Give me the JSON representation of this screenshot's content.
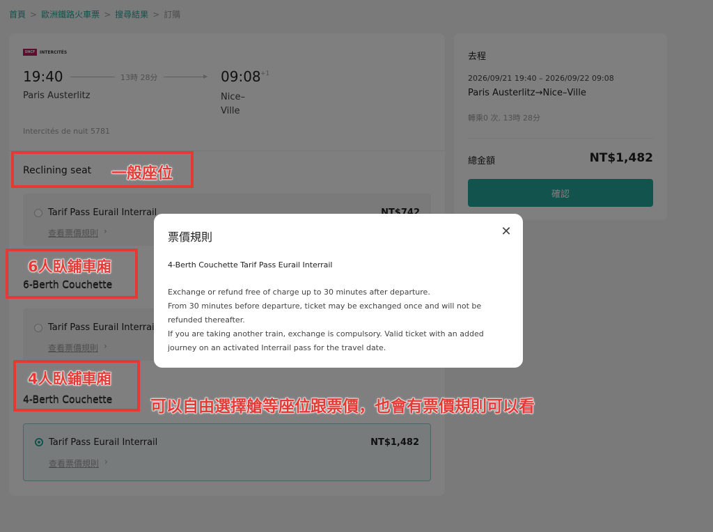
{
  "breadcrumb": {
    "home": "首頁",
    "category": "歐洲鐵路火車票",
    "results": "搜尋結果",
    "current": "訂購",
    "separator": ">"
  },
  "train": {
    "operator_logo": "SNCF",
    "operator_brand": "INTERCITÉS",
    "departure_time": "19:40",
    "departure_station": "Paris Austerlitz",
    "duration": "13時 28分",
    "arrival_time": "09:08",
    "arrival_day_offset": "+1",
    "arrival_station": "Nice–Ville",
    "train_number": "Intercités de nuit 5781"
  },
  "classes": [
    {
      "name": "Reclining seat",
      "fares": [
        {
          "name": "Tarif Pass Eurail Interrail",
          "price": "NT$742",
          "rules_link": "查看票價規則",
          "selected": false
        }
      ]
    },
    {
      "name": "6-Berth Couchette",
      "fares": [
        {
          "name": "Tarif Pass Eurail Interrail",
          "price": "",
          "rules_link": "查看票價規則",
          "selected": false
        }
      ]
    },
    {
      "name": "4-Berth Couchette",
      "fares": [
        {
          "name": "Tarif Pass Eurail Interrail",
          "price": "NT$1,482",
          "rules_link": "查看票價規則",
          "selected": true
        }
      ]
    }
  ],
  "summary": {
    "title": "去程",
    "dates": "2026/09/21 19:40 – 2026/09/22 09:08",
    "route": "Paris Austerlitz→Nice–Ville",
    "transfer": "轉乘0 次, 13時 28分",
    "total_label": "總金額",
    "total_value": "NT$1,482",
    "confirm_label": "確認"
  },
  "modal": {
    "title": "票價規則",
    "subtitle": "4-Berth Couchette Tarif Pass Eurail Interrail",
    "lines": [
      "Exchange or refund free of charge up to 30 minutes after departure.",
      "From 30 minutes before departure, ticket may be exchanged once and will not be",
      "refunded thereafter.",
      "If you are taking another train, exchange is compulsory. Valid ticket with an added",
      "journey on an activated Interrail pass for the travel date."
    ],
    "close_icon": "close-icon"
  },
  "annotations": {
    "seat": "一般座位",
    "six_berth": "6人臥鋪車廂",
    "four_berth": "4人臥鋪車廂",
    "note": "可以自由選擇艙等座位跟票價，也會有票價規則可以看"
  },
  "colors": {
    "accent": "#26a69a",
    "annotation": "#e53935",
    "sncf": "#b71c5b"
  }
}
